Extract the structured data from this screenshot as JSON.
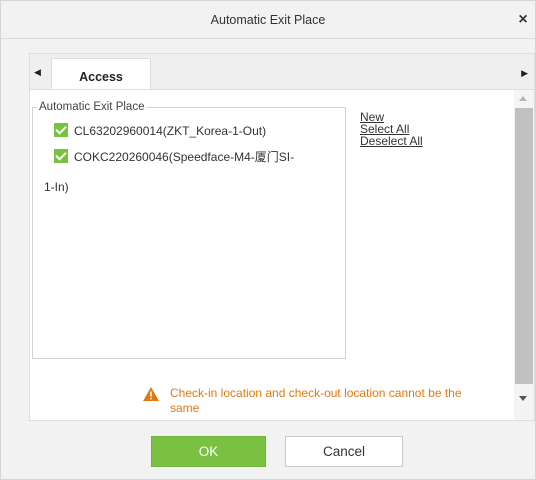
{
  "dialog": {
    "title": "Automatic Exit Place",
    "close_symbol": "×"
  },
  "tabs": {
    "left_arrow": "◀",
    "right_arrow": "▶",
    "active_tab": "Access"
  },
  "fieldset": {
    "legend": "Automatic Exit Place",
    "items": [
      {
        "label": "CL63202960014(ZKT_Korea-1-Out)",
        "checked": true
      },
      {
        "label": "COKC220260046(Speedface-M4-厦门SI-",
        "label_cont": "1-In)",
        "checked": true
      }
    ]
  },
  "actions": {
    "new": "New",
    "select_all": "Select All",
    "deselect_all": "Deselect All"
  },
  "warning": {
    "icon": "warning-triangle-icon",
    "text": "Check-in location and check-out location cannot be the same"
  },
  "footer": {
    "ok_label": "OK",
    "cancel_label": "Cancel"
  },
  "colors": {
    "accent_green": "#7ac142",
    "warning_orange": "#e07a10"
  }
}
